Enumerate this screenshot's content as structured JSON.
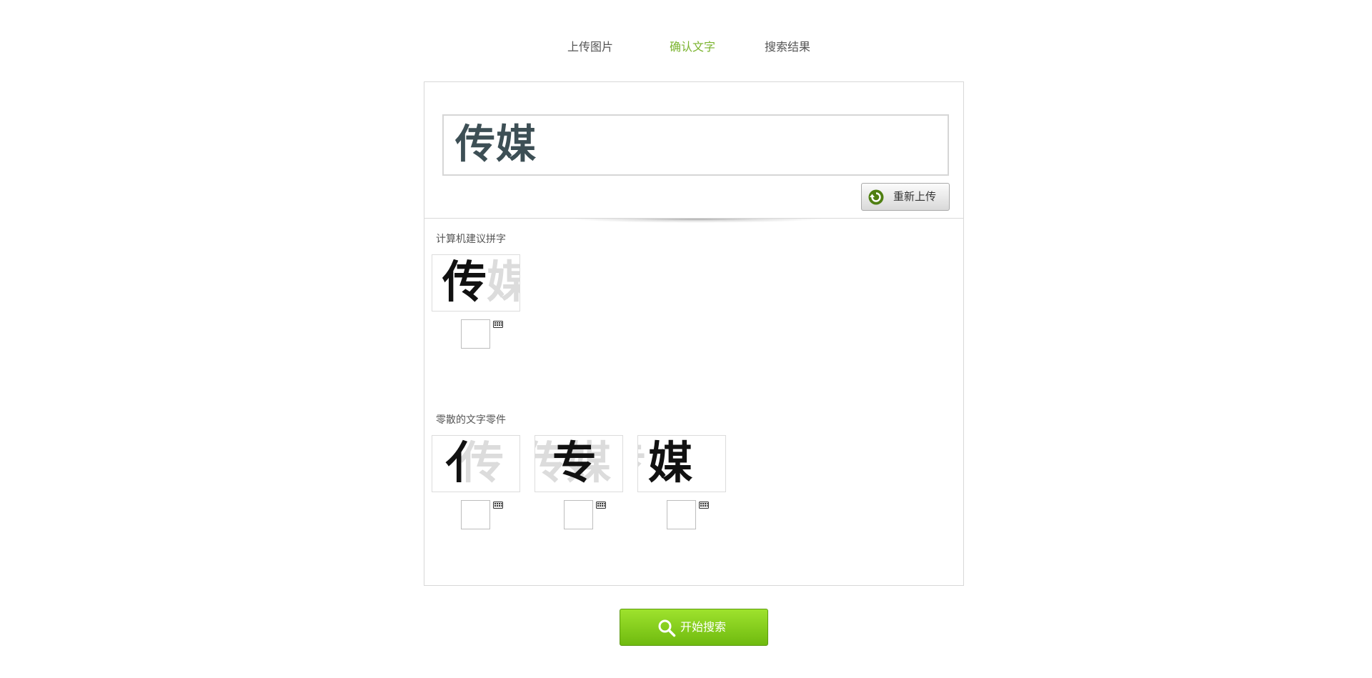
{
  "steps": [
    {
      "label": "上传图片",
      "active": false
    },
    {
      "label": "确认文字",
      "active": true
    },
    {
      "label": "搜索结果",
      "active": false
    }
  ],
  "recognized_text": "传媒",
  "reupload_label": "重新上传",
  "suggested": {
    "title": "计算机建议拼字",
    "items": [
      {
        "dark": "传",
        "faint": "媒",
        "value": ""
      }
    ]
  },
  "parts": {
    "title": "零散的文字零件",
    "items": [
      {
        "dark": "亻",
        "faint": "传",
        "value": ""
      },
      {
        "dark": "专",
        "faint": "传媒",
        "value": ""
      },
      {
        "dark": "媒",
        "faint": "专",
        "value": ""
      }
    ]
  },
  "search_label": "开始搜索",
  "colors": {
    "accent": "#7ab32e",
    "big_text": "#3d4f55",
    "search_button": "#8ed321"
  }
}
